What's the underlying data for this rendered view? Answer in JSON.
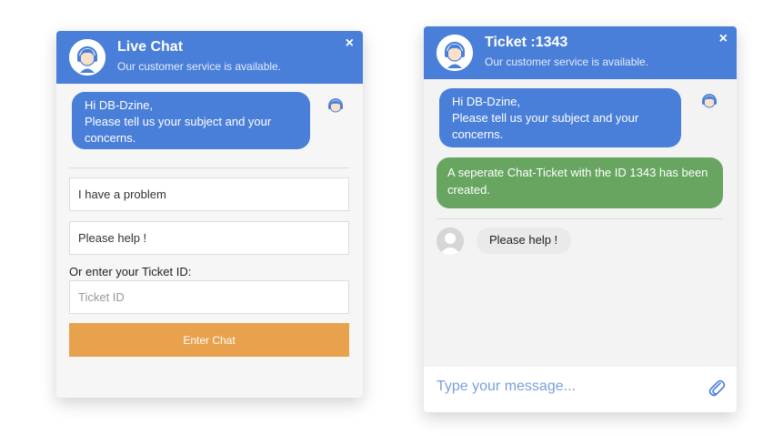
{
  "colors": {
    "header": "#4a7fd9",
    "bubble_agent": "#4a7fd9",
    "bubble_system": "#67a561",
    "button": "#e8a24e",
    "composer_text": "#7b9ee0"
  },
  "left_widget": {
    "title": "Live Chat",
    "subtitle": "Our customer service is available.",
    "close_icon": "×",
    "greeting": {
      "line1": "Hi DB-Dzine,",
      "line2": "Please tell us your subject and your",
      "line3": "concerns."
    },
    "subject_value": "I have a problem",
    "message_value": "Please help !",
    "ticket_label": "Or enter your Ticket ID:",
    "ticket_placeholder": "Ticket ID",
    "enter_button": "Enter Chat"
  },
  "right_widget": {
    "title": "Ticket :1343",
    "subtitle": "Our customer service is available.",
    "close_icon": "×",
    "greeting": {
      "line1": "Hi DB-Dzine,",
      "line2": "Please tell us your subject and your",
      "line3": "concerns."
    },
    "system_message": {
      "line1": "A seperate Chat-Ticket with the ID 1343 has been",
      "line2": "created."
    },
    "user_message": "Please help !",
    "composer_placeholder": "Type your message...",
    "attach_icon": "paperclip-icon"
  }
}
